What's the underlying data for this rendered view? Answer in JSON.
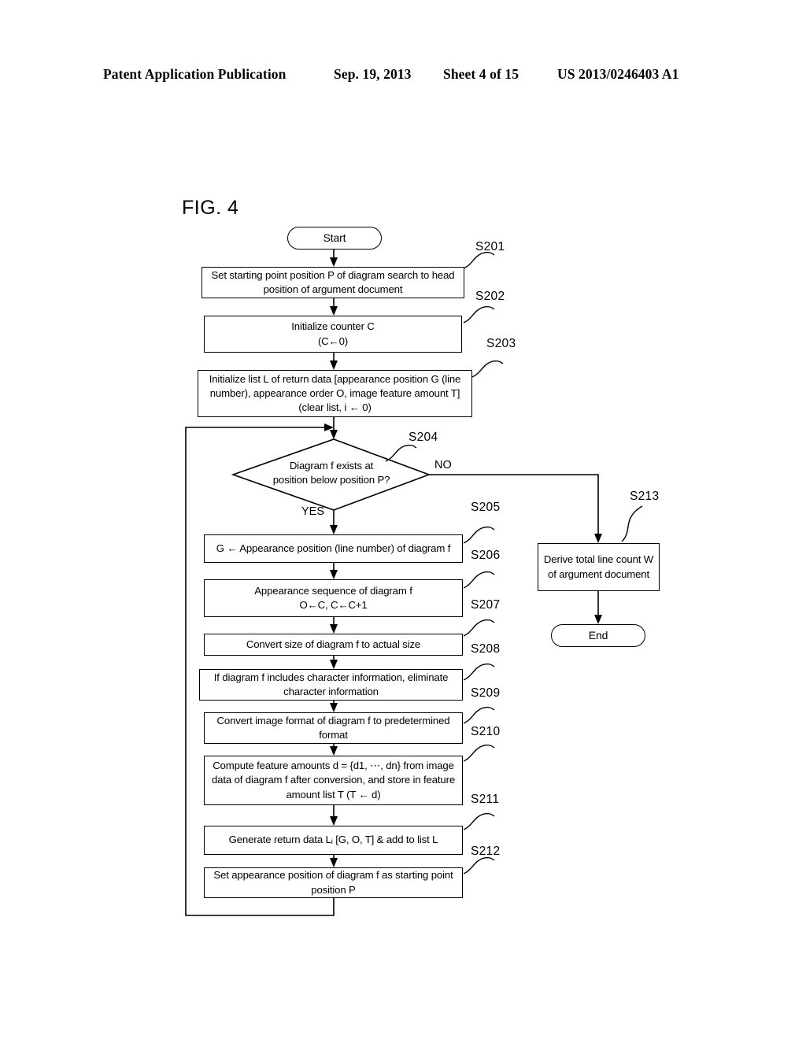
{
  "header": {
    "publication": "Patent Application Publication",
    "date": "Sep. 19, 2013",
    "sheet": "Sheet 4 of 15",
    "patent_number": "US 2013/0246403 A1"
  },
  "figure": {
    "label": "FIG. 4"
  },
  "flowchart": {
    "start": {
      "label": "Start"
    },
    "end": {
      "label": "End"
    },
    "branch_yes": "YES",
    "branch_no": "NO",
    "decision": {
      "step": "S204",
      "line1": "Diagram f exists at",
      "line2": "position below position P?"
    },
    "steps": [
      {
        "step": "S201",
        "text": "Set starting point position P of diagram search to head position of argument document"
      },
      {
        "step": "S202",
        "text": "Initialize counter C\n(C←0)"
      },
      {
        "step": "S203",
        "text": "Initialize list L of return data [appearance position G (line number), appearance order O, image feature amount T] (clear list, i ← 0)"
      },
      {
        "step": "S205",
        "text": "G ← Appearance position (line number) of diagram f"
      },
      {
        "step": "S206",
        "text": "Appearance sequence of diagram f\nO←C, C←C+1"
      },
      {
        "step": "S207",
        "text": "Convert size of diagram f to actual size"
      },
      {
        "step": "S208",
        "text": "If diagram f includes character information, eliminate character information"
      },
      {
        "step": "S209",
        "text": "Convert image format of diagram f to predetermined format"
      },
      {
        "step": "S210",
        "text": "Compute feature amounts d = {d1, ⋯, dn} from image data of diagram f after conversion, and store in feature amount list T (T ← d)"
      },
      {
        "step": "S211",
        "text": "Generate return data Lᵢ [G, O, T] & add to list L"
      },
      {
        "step": "S212",
        "text": "Set appearance position of diagram f as starting point position P"
      },
      {
        "step": "S213",
        "text": "Derive total line count W of argument document"
      }
    ]
  },
  "colors": {
    "ink": "#000000",
    "paper": "#ffffff"
  }
}
